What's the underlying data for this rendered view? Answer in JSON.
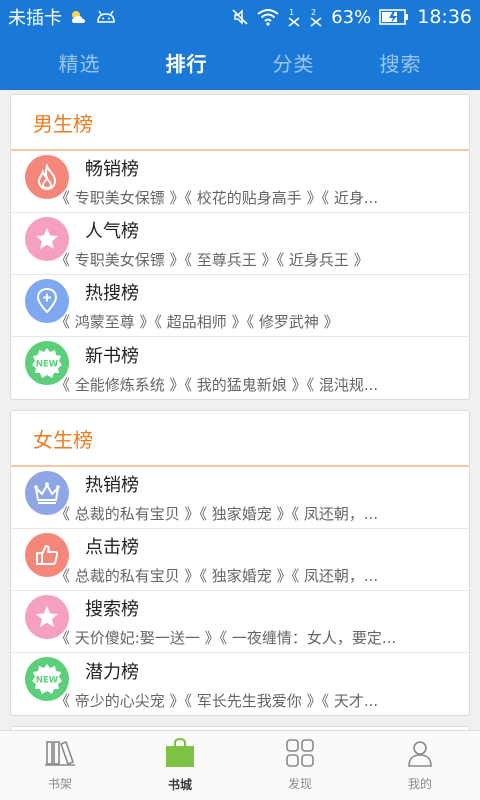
{
  "status_bar": {
    "carrier": "未插卡",
    "battery_percent": "63%",
    "time": "18:36",
    "colors": {
      "background": "#1a78d6"
    }
  },
  "top_tabs": [
    {
      "label": "精选",
      "active": false
    },
    {
      "label": "排行",
      "active": true
    },
    {
      "label": "分类",
      "active": false
    },
    {
      "label": "搜索",
      "active": false
    }
  ],
  "male_section": {
    "header": "男生榜",
    "rows": [
      {
        "title": "畅销榜",
        "subtitle": "《 专职美女保镖 》《 校花的贴身高手 》《 近身...",
        "icon": "fire-icon",
        "icon_color": "#f4877a"
      },
      {
        "title": "人气榜",
        "subtitle": "《 专职美女保镖 》《 至尊兵王 》《 近身兵王 》",
        "icon": "star-icon",
        "icon_color": "#f5a0c0"
      },
      {
        "title": "热搜榜",
        "subtitle": "《 鸿蒙至尊 》《 超品相师 》《 修罗武神 》",
        "icon": "location-pin-icon",
        "icon_color": "#7ea9f0"
      },
      {
        "title": "新书榜",
        "subtitle": "《 全能修炼系统 》《 我的猛鬼新娘 》《 混沌规...",
        "icon": "new-badge-icon",
        "icon_color": "#5ccf7b"
      }
    ]
  },
  "female_section": {
    "header": "女生榜",
    "rows": [
      {
        "title": "热销榜",
        "subtitle": "《 总裁的私有宝贝 》《 独家婚宠 》《 凤还朝，...",
        "icon": "crown-icon",
        "icon_color": "#8ea5e6"
      },
      {
        "title": "点击榜",
        "subtitle": "《 总裁的私有宝贝 》《 独家婚宠 》《 凤还朝，...",
        "icon": "thumbs-up-icon",
        "icon_color": "#f4877a"
      },
      {
        "title": "搜索榜",
        "subtitle": "《 天价傻妃:娶一送一 》《 一夜缠情：女人，要定...",
        "icon": "star-icon",
        "icon_color": "#f5a0c0"
      },
      {
        "title": "潜力榜",
        "subtitle": "《 帝少的心尖宠 》《 军长先生我爱你 》《 天才...",
        "icon": "new-badge-icon",
        "icon_color": "#5ccf7b"
      }
    ]
  },
  "bottom_nav": [
    {
      "label": "书架",
      "icon": "bookshelf-icon",
      "active": false
    },
    {
      "label": "书城",
      "icon": "shopping-bag-icon",
      "active": true
    },
    {
      "label": "发现",
      "icon": "grid-icon",
      "active": false
    },
    {
      "label": "我的",
      "icon": "person-icon",
      "active": false
    }
  ],
  "colors": {
    "primary": "#1a78d6",
    "section_header": "#f07c22",
    "active_nav": "#7dc243"
  }
}
